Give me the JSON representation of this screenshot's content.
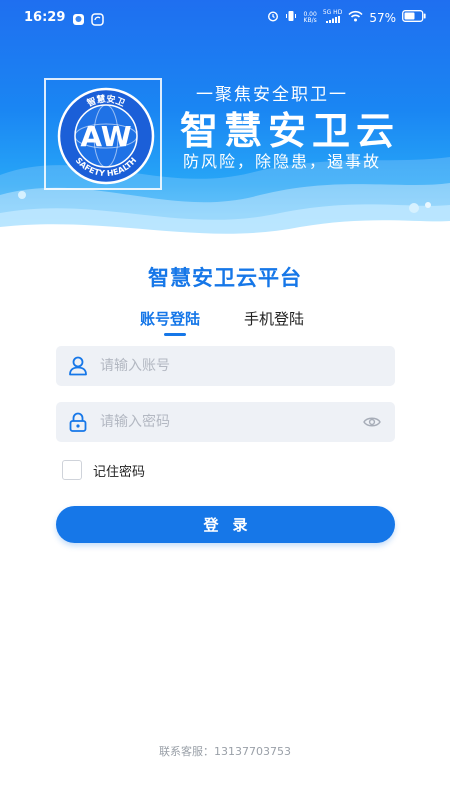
{
  "status_bar": {
    "time": "16:29",
    "net_speed_value": "0.00",
    "net_speed_unit": "KB/s",
    "network_type": "5G HD",
    "battery": "57%",
    "icons": [
      "gallery-icon",
      "sync-icon",
      "alarm-icon",
      "vibrate-icon",
      "wifi-icon",
      "signal-icon",
      "battery-icon"
    ]
  },
  "banner": {
    "slogan_top": "一聚焦安全职卫一",
    "title": "智慧安卫云",
    "slogan_bottom": "防风险，除隐患，遏事故",
    "logo": {
      "monogram": "AW",
      "ring_top_text": "智慧安卫",
      "ring_bottom_text": "SAFETY HEALTH"
    },
    "colors": {
      "top": "#1f6ff0",
      "bottom": "#5cc6fb"
    }
  },
  "login": {
    "platform_title": "智慧安卫云平台",
    "tabs": [
      {
        "label": "账号登陆",
        "active": true
      },
      {
        "label": "手机登陆",
        "active": false
      }
    ],
    "account": {
      "placeholder": "请输入账号",
      "value": ""
    },
    "password": {
      "placeholder": "请输入密码",
      "value": ""
    },
    "remember_label": "记住密码",
    "remember_checked": false,
    "login_button": "登录"
  },
  "footer": {
    "contact": "联系客服：13137703753"
  },
  "colors": {
    "accent": "#1677e8",
    "field_bg": "#eef1f6",
    "muted": "#9aa0a8"
  }
}
